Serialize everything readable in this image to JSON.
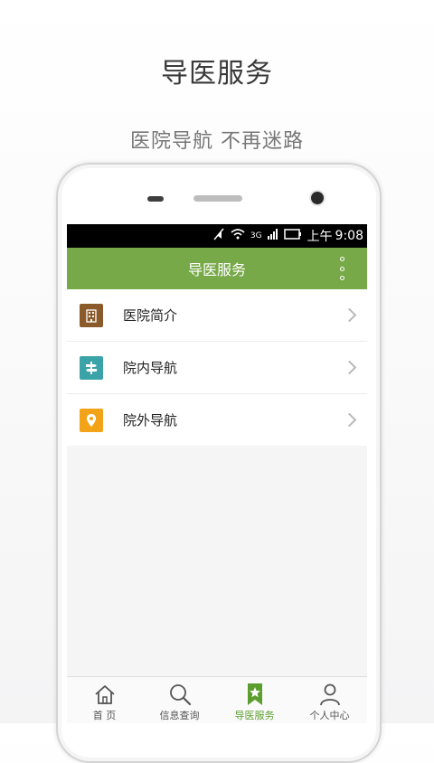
{
  "promo": {
    "title": "导医服务",
    "subtitle": "医院导航 不再迷路"
  },
  "status_bar": {
    "network_label": "3G",
    "time_prefix": "上午",
    "time": "9:08",
    "icons": [
      "mute-icon",
      "wifi-icon",
      "signal-icon",
      "battery-icon"
    ]
  },
  "app_bar": {
    "title": "导医服务",
    "menu_icon": "more-vertical-icon",
    "color": "#77a948"
  },
  "menu": {
    "items": [
      {
        "label": "医院简介",
        "icon": "building-icon",
        "color": "#8a5a2b"
      },
      {
        "label": "院内导航",
        "icon": "signpost-icon",
        "color": "#3aa3a7"
      },
      {
        "label": "院外导航",
        "icon": "location-pin-icon",
        "color": "#f3a317"
      }
    ]
  },
  "tabbar": {
    "active_color": "#5c9e2e",
    "tabs": [
      {
        "label": "首 页",
        "icon": "home-icon",
        "active": false
      },
      {
        "label": "信息查询",
        "icon": "search-icon",
        "active": false
      },
      {
        "label": "导医服务",
        "icon": "bookmark-star-icon",
        "active": true
      },
      {
        "label": "个人中心",
        "icon": "person-icon",
        "active": false
      }
    ]
  }
}
